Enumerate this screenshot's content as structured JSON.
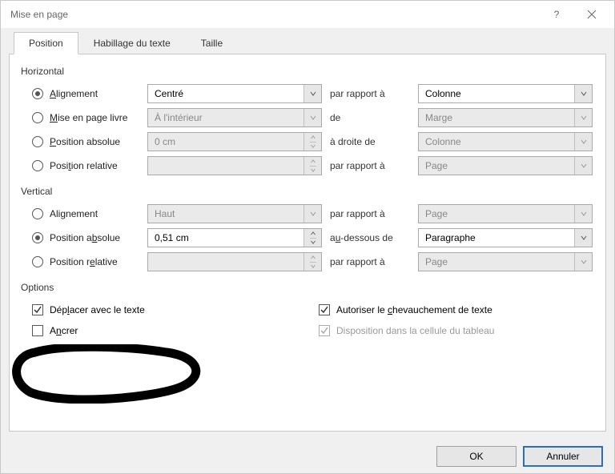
{
  "window": {
    "title": "Mise en page"
  },
  "tabs": {
    "position": "Position",
    "habillage": "Habillage du texte",
    "taille": "Taille"
  },
  "horizontal": {
    "label": "Horizontal",
    "alignement": {
      "label": "Alignement",
      "value": "Centré",
      "rel_label": "par rapport à",
      "rel_value": "Colonne"
    },
    "miseenpage": {
      "label": "Mise en page livre",
      "value": "À l'intérieur",
      "rel_label": "de",
      "rel_value": "Marge"
    },
    "posabs": {
      "label": "Position absolue",
      "value": "0 cm",
      "rel_label": "à droite de",
      "rel_value": "Colonne"
    },
    "posrel": {
      "label": "Position relative",
      "value": "",
      "rel_label": "par rapport à",
      "rel_value": "Page"
    }
  },
  "vertical": {
    "label": "Vertical",
    "alignement": {
      "label": "Alignement",
      "value": "Haut",
      "rel_label": "par rapport à",
      "rel_value": "Page"
    },
    "posabs": {
      "label": "Position absolue",
      "value": "0,51 cm",
      "rel_label": "au-dessous de",
      "rel_value": "Paragraphe"
    },
    "posrel": {
      "label": "Position relative",
      "value": "",
      "rel_label": "par rapport à",
      "rel_value": "Page"
    }
  },
  "options": {
    "label": "Options",
    "deplacer": "Déplacer avec le texte",
    "ancrer": "Ancrer",
    "chevauchement": "Autoriser le chevauchement de texte",
    "disposition": "Disposition dans la cellule du tableau"
  },
  "buttons": {
    "ok": "OK",
    "annuler": "Annuler"
  }
}
